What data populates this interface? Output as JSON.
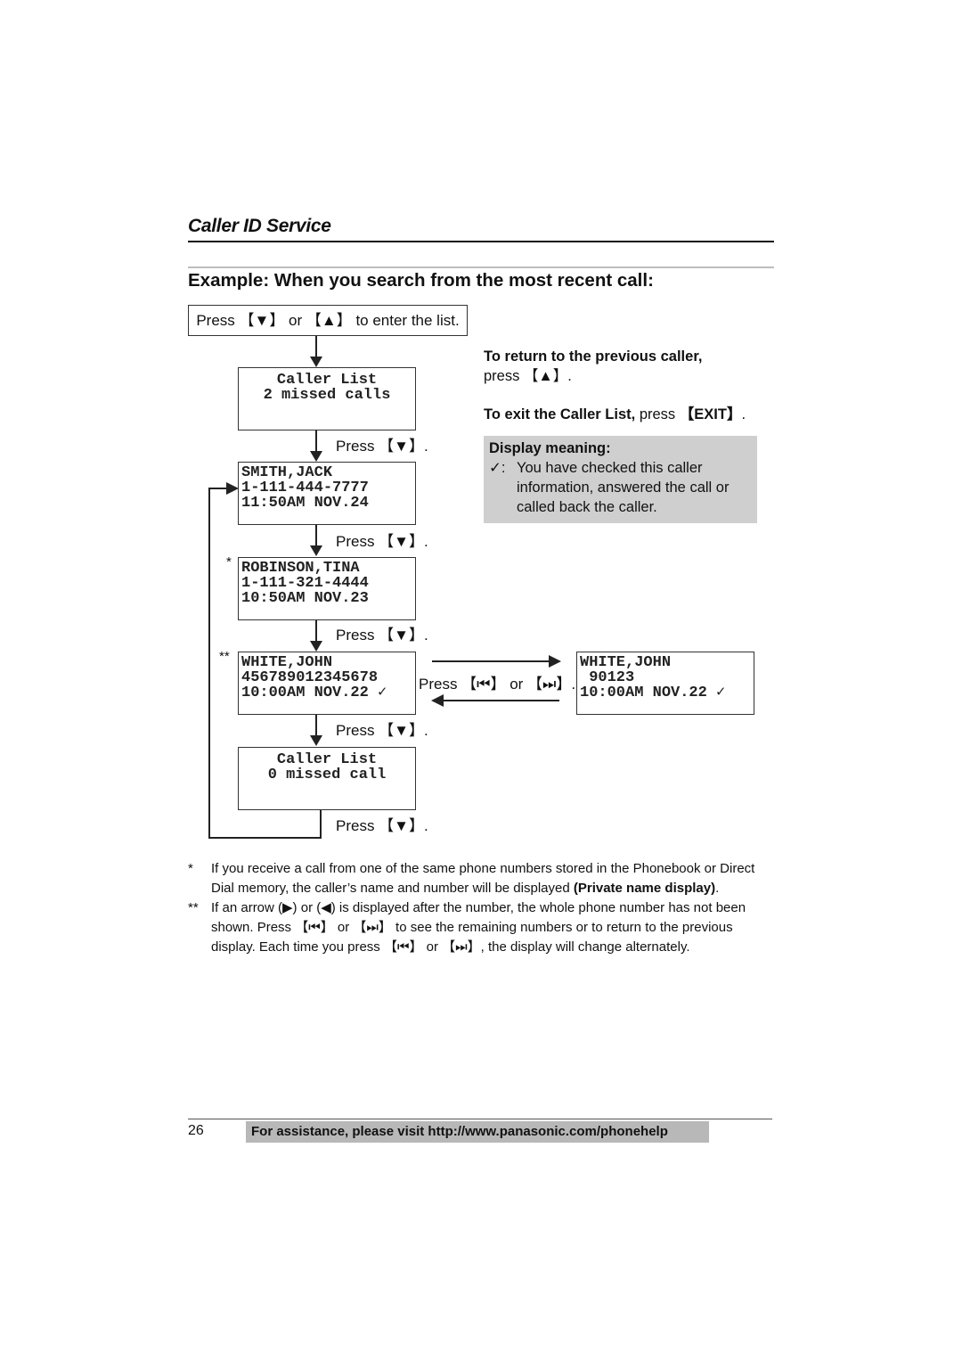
{
  "section_title": "Caller ID Service",
  "heading": "Example: When you search from the most recent call:",
  "enter_instruction": "Press 【▼】 or 【▲】 to enter the list.",
  "press_down": "Press 【▼】.",
  "press_skip": "Press 【⏮】 or 【⏭】.",
  "screens": {
    "caller_list_start": {
      "line1": "Caller List",
      "line2": "2 missed calls"
    },
    "smith": {
      "line1": "SMITH,JACK",
      "line2": "1-111-444-7777",
      "line3": "11:50AM NOV.24"
    },
    "robinson": {
      "mark": "*",
      "line1": "ROBINSON,TINA",
      "line2": "1-111-321-4444",
      "line3": "10:50AM NOV.23"
    },
    "white": {
      "mark": "**",
      "line1": "WHITE,JOHN",
      "line2": "456789012345678",
      "line3": "10:00AM NOV.22",
      "check": "✓"
    },
    "white_alt": {
      "line1": "WHITE,JOHN",
      "line2": " 90123",
      "line3": "10:00AM NOV.22",
      "check": "✓"
    },
    "caller_list_end": {
      "line1": "Caller List",
      "line2": "0 missed call"
    }
  },
  "side_notes": {
    "return_bold": "To return to the previous caller,",
    "return_rest": "press 【▲】.",
    "exit_bold": "To exit the Caller List,",
    "exit_rest": " press ",
    "exit_key": "【EXIT】",
    "exit_end": "."
  },
  "display_meaning": {
    "title": "Display meaning:",
    "symbol": "✓:",
    "text": "You have checked this caller information, answered the call or called back the caller."
  },
  "footnotes": [
    {
      "mark": "*",
      "text": "If you receive a call from one of the same phone numbers stored in the Phonebook or Direct Dial memory, the caller’s name and number will be displayed ",
      "bold": "(Private name display)",
      "end": "."
    },
    {
      "mark": "**",
      "text": "If an arrow (▶) or (◀) is displayed after the number, the whole phone number has not been shown. Press 【⏮】 or 【⏭】 to see the remaining numbers or to return to the previous display. Each time you press 【⏮】 or 【⏭】, the display will change alternately."
    }
  ],
  "footer": {
    "page_number": "26",
    "help_text": "For assistance, please visit http://www.panasonic.com/phonehelp"
  }
}
